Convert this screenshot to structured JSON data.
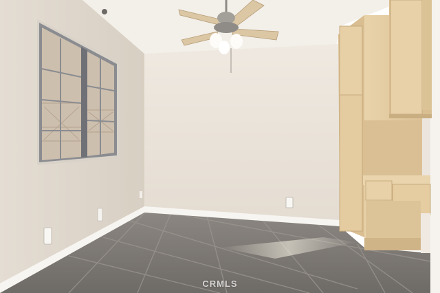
{
  "watermark": {
    "text": "CRMLS"
  },
  "colors": {
    "wall_back": "#ebe4da",
    "wall_left": "#ddd5ca",
    "ceiling": "#f3efe9",
    "cabinet_wood": "#e6cfa6",
    "cabinet_shadow": "#c9ae82",
    "baseboard": "#f7f5f1",
    "floor_tile": "#7d7a78",
    "window_frame": "#8a8c90",
    "fan_blade": "#dcc7a4"
  },
  "icons": [
    "ceiling-fan-icon",
    "window-icon",
    "electrical-outlet-icon"
  ]
}
